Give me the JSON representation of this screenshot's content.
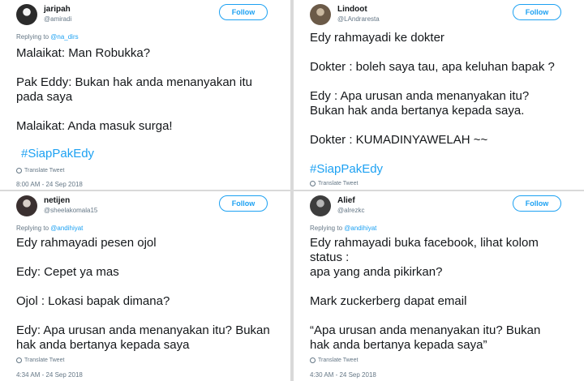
{
  "tweets": [
    {
      "display_name": "jaripah",
      "handle": "@amiradi",
      "follow_label": "Follow",
      "replying_prefix": "Replying to",
      "replying_to": "@na_dirs",
      "lines": [
        "Malaikat: Man Robukka?",
        "",
        "Pak Eddy: Bukan hak anda menanyakan itu\npada saya",
        "",
        "Malaikat: Anda masuk surga!"
      ],
      "hashtag": "#SiapPakEdy",
      "translate": "Translate Tweet",
      "timestamp": "8:00 AM - 24 Sep 2018",
      "avatar_colors": [
        "#2b2b2b",
        "#f2f2f2"
      ]
    },
    {
      "display_name": "Lindoot",
      "handle": "@LAndraresta",
      "follow_label": "Follow",
      "replying_prefix": "",
      "replying_to": "",
      "lines": [
        "Edy rahmayadi ke dokter",
        "",
        "Dokter : boleh saya tau, apa keluhan bapak ?",
        "",
        "Edy : Apa urusan anda menanyakan itu?\nBukan hak anda bertanya kepada saya.",
        "",
        "Dokter : KUMADINYAWELAH ~~"
      ],
      "hashtag": "#SiapPakEdy",
      "translate": "Translate Tweet",
      "timestamp": "",
      "avatar_colors": [
        "#6b5a48",
        "#c9b8a0"
      ]
    },
    {
      "display_name": "netijen",
      "handle": "@sheelakomala15",
      "follow_label": "Follow",
      "replying_prefix": "Replying to",
      "replying_to": "@andihiyat",
      "lines": [
        "Edy rahmayadi pesen ojol",
        "",
        "Edy: Cepet ya mas",
        "",
        "Ojol : Lokasi bapak dimana?",
        "",
        "Edy: Apa urusan anda menanyakan itu? Bukan\nhak anda bertanya kepada saya"
      ],
      "hashtag": "",
      "translate": "Translate Tweet",
      "timestamp": "4:34 AM - 24 Sep 2018",
      "avatar_colors": [
        "#3a3030",
        "#d8cfc8"
      ]
    },
    {
      "display_name": "Alief",
      "handle": "@alrezkc",
      "follow_label": "Follow",
      "replying_prefix": "Replying to",
      "replying_to": "@andihiyat",
      "lines": [
        "Edy rahmayadi buka facebook, lihat kolom\nstatus :\napa yang anda pikirkan?",
        "",
        "Mark zuckerberg dapat email",
        "",
        "“Apa urusan anda menanyakan itu? Bukan\nhak anda bertanya kepada saya”"
      ],
      "hashtag": "",
      "translate": "Translate Tweet",
      "timestamp": "4:30 AM - 24 Sep 2018",
      "avatar_colors": [
        "#3d3d3d",
        "#b5b5b5"
      ]
    }
  ]
}
